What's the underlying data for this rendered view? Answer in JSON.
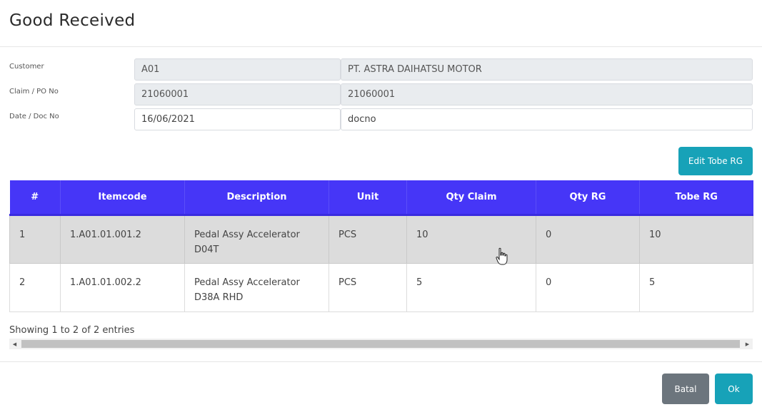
{
  "modal": {
    "title": "Good Received"
  },
  "form": {
    "customer": {
      "label": "Customer",
      "code": "A01",
      "name": "PT. ASTRA DAIHATSU MOTOR"
    },
    "claim": {
      "label": "Claim / PO No",
      "value1": "21060001",
      "value2": "21060001"
    },
    "date": {
      "label": "Date / Doc No",
      "date": "16/06/2021",
      "doc_no": "docno"
    }
  },
  "toolbar": {
    "edit_label": "Edit Tobe RG"
  },
  "table": {
    "headers": [
      "#",
      "Itemcode",
      "Description",
      "Unit",
      "Qty Claim",
      "Qty RG",
      "Tobe RG"
    ],
    "rows": [
      {
        "no": "1",
        "itemcode": "1.A01.01.001.2",
        "desc_line1": "Pedal Assy Accelerator",
        "desc_line2": "D04T",
        "unit": "PCS",
        "qty_claim": "10",
        "qty_rg": "0",
        "tobe_rg": "10"
      },
      {
        "no": "2",
        "itemcode": "1.A01.01.002.2",
        "desc_line1": "Pedal Assy Accelerator",
        "desc_line2": "D38A RHD",
        "unit": "PCS",
        "qty_claim": "5",
        "qty_rg": "0",
        "tobe_rg": "5"
      }
    ],
    "info": "Showing 1 to 2 of 2 entries"
  },
  "footer": {
    "cancel_label": "Batal",
    "ok_label": "Ok"
  },
  "colors": {
    "header_bg": "#4636f7",
    "accent_teal": "#17a2b8",
    "cancel_gray": "#6c757d",
    "highlight_row": "#dcdcdc"
  }
}
